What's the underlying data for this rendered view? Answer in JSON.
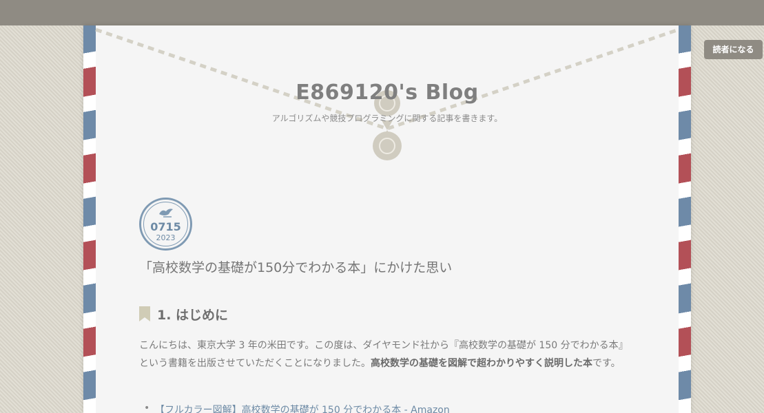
{
  "header": {
    "follow_label": "読者になる"
  },
  "blog": {
    "title": "E869120's Blog",
    "description": "アルゴリズムや競技プログラミングに関する記事を書きます。"
  },
  "entry": {
    "date_md": "0715",
    "date_year": "2023",
    "title": "「高校数学の基礎が150分でわかる本」にかけた思い",
    "section_heading": "1. はじめに",
    "paragraph_plain": "こんにちは、東京大学 3 年の米田です。この度は、ダイヤモンド社から『高校数学の基礎が 150 分でわかる本』という書籍を出版させていただくことになりました。",
    "paragraph_bold": "高校数学の基礎を図解で超わかりやすく説明した本",
    "paragraph_tail": "です。",
    "link_text": "【フルカラー図解】高校数学の基礎が 150 分でわかる本 - Amazon"
  },
  "colors": {
    "airmail_blue": "#6e8aa8",
    "airmail_red": "#b35057",
    "topbar": "#8f8b83"
  },
  "icons": {
    "bookmark": "bookmark-icon",
    "seal": "wax-seal-icon",
    "bird": "bird-icon"
  }
}
